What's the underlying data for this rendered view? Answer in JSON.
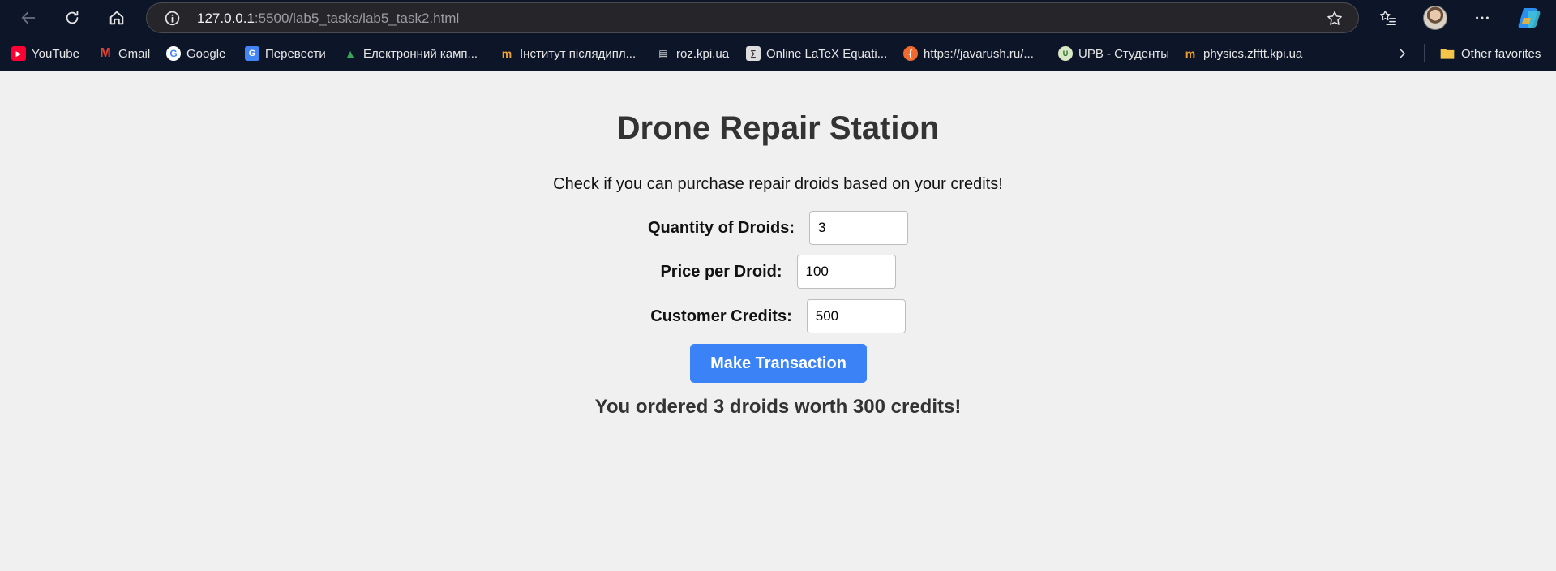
{
  "browser": {
    "url_host": "127.0.0.1",
    "url_rest": ":5500/lab5_tasks/lab5_task2.html",
    "bookmarks": [
      {
        "label": "YouTube",
        "icon": "youtube-icon"
      },
      {
        "label": "Gmail",
        "icon": "gmail-icon"
      },
      {
        "label": "Google",
        "icon": "google-icon"
      },
      {
        "label": "Перевести",
        "icon": "translate-icon"
      },
      {
        "label": "Електронний камп...",
        "icon": "campus-icon"
      },
      {
        "label": "Інститут післядипл...",
        "icon": "institute-icon"
      },
      {
        "label": "roz.kpi.ua",
        "icon": "document-icon"
      },
      {
        "label": "Online LaTeX Equati...",
        "icon": "latex-icon"
      },
      {
        "label": "https://javarush.ru/...",
        "icon": "javarush-icon"
      },
      {
        "label": "UPB - Студенты",
        "icon": "upb-icon"
      },
      {
        "label": "physics.zfftt.kpi.ua",
        "icon": "physics-icon"
      }
    ],
    "other_favorites": "Other favorites"
  },
  "page": {
    "title": "Drone Repair Station",
    "subtitle": "Check if you can purchase repair droids based on your credits!",
    "quantity_label": "Quantity of Droids:",
    "quantity_value": "3",
    "price_label": "Price per Droid:",
    "price_value": "100",
    "credits_label": "Customer Credits:",
    "credits_value": "500",
    "button_label": "Make Transaction",
    "result": "You ordered 3 droids worth 300 credits!"
  },
  "colors": {
    "accent": "#3b82f6",
    "page_bg": "#f0f0f0",
    "chrome_bg": "#0d1628"
  }
}
